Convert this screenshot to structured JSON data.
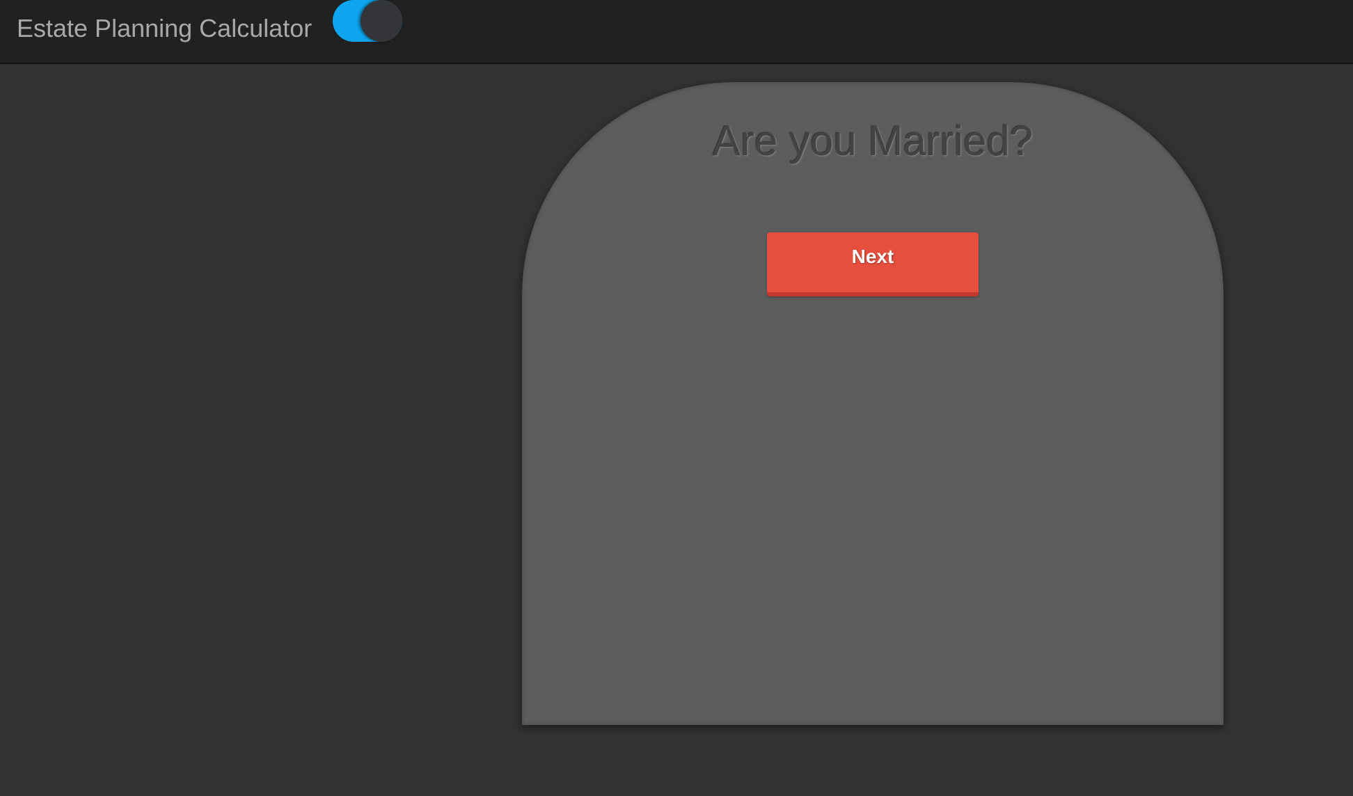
{
  "header": {
    "title": "Estate Planning Calculator",
    "theme_toggle": {
      "state": "on",
      "track_color": "#0ea5ef",
      "knob_color": "#333538"
    }
  },
  "main": {
    "question": "Are you Married?",
    "next_button_label": "Next",
    "next_button_color": "#e64f3e"
  },
  "colors": {
    "page_background": "#323232",
    "header_background": "#212121",
    "card_background": "#5d5d5d"
  }
}
